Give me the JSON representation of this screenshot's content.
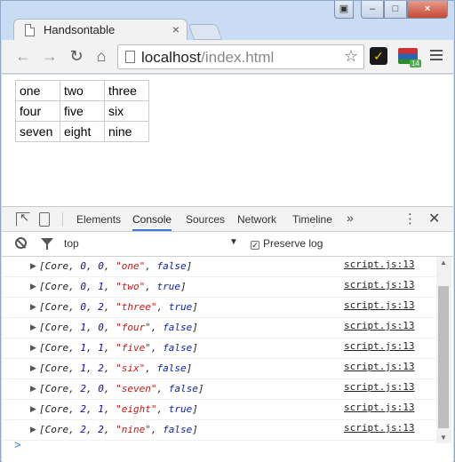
{
  "browser": {
    "tab_title": "Handsontable",
    "tab_close": "×",
    "url_host": "localhost",
    "url_path": "/index.html",
    "icons": [
      "back-icon",
      "forward-icon",
      "reload-icon",
      "home-icon",
      "star-icon",
      "menu-icon"
    ],
    "window_controls": {
      "minimize": "–",
      "maximize": "□",
      "close": "×"
    }
  },
  "table": {
    "rows": [
      [
        "one",
        "two",
        "three"
      ],
      [
        "four",
        "five",
        "six"
      ],
      [
        "seven",
        "eight",
        "nine"
      ]
    ]
  },
  "devtools": {
    "tabs": [
      "Elements",
      "Console",
      "Sources",
      "Network",
      "Timeline"
    ],
    "active_tab": "Console",
    "more": "»",
    "kebab": "⋮",
    "close": "✕",
    "context": "top",
    "preserve_log": "Preserve log",
    "prompt": ">"
  },
  "console": {
    "entries": [
      {
        "row": "0",
        "col": "0",
        "value": "\"one\"",
        "flag": "false",
        "source": "script.js:13"
      },
      {
        "row": "0",
        "col": "1",
        "value": "\"two\"",
        "flag": "true",
        "source": "script.js:13"
      },
      {
        "row": "0",
        "col": "2",
        "value": "\"three\"",
        "flag": "true",
        "source": "script.js:13"
      },
      {
        "row": "1",
        "col": "0",
        "value": "\"four\"",
        "flag": "false",
        "source": "script.js:13"
      },
      {
        "row": "1",
        "col": "1",
        "value": "\"five\"",
        "flag": "false",
        "source": "script.js:13"
      },
      {
        "row": "1",
        "col": "2",
        "value": "\"six\"",
        "flag": "false",
        "source": "script.js:13"
      },
      {
        "row": "2",
        "col": "0",
        "value": "\"seven\"",
        "flag": "false",
        "source": "script.js:13"
      },
      {
        "row": "2",
        "col": "1",
        "value": "\"eight\"",
        "flag": "true",
        "source": "script.js:13"
      },
      {
        "row": "2",
        "col": "2",
        "value": "\"nine\"",
        "flag": "false",
        "source": "script.js:13"
      }
    ]
  }
}
